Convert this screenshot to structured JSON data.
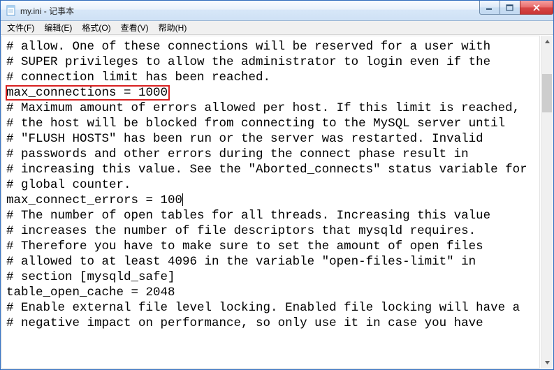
{
  "window": {
    "title": "my.ini - 记事本"
  },
  "menu": {
    "file": "文件(F)",
    "edit": "编辑(E)",
    "format": "格式(O)",
    "view": "查看(V)",
    "help": "帮助(H)"
  },
  "content": {
    "l1": "# allow. One of these connections will be reserved for a user with",
    "l2": "# SUPER privileges to allow the administrator to login even if the",
    "l3": "# connection limit has been reached.",
    "l4": "max_connections = 1000",
    "l5": "",
    "l6": "# Maximum amount of errors allowed per host. If this limit is reached,",
    "l7": "# the host will be blocked from connecting to the MySQL server until",
    "l8": "# \"FLUSH HOSTS\" has been run or the server was restarted. Invalid",
    "l9": "# passwords and other errors during the connect phase result in",
    "l10": "# increasing this value. See the \"Aborted_connects\" status variable for",
    "l11": "# global counter.",
    "l12": "max_connect_errors = 100",
    "l13": "",
    "l14": "# The number of open tables for all threads. Increasing this value",
    "l15": "# increases the number of file descriptors that mysqld requires.",
    "l16": "# Therefore you have to make sure to set the amount of open files",
    "l17": "# allowed to at least 4096 in the variable \"open-files-limit\" in",
    "l18": "# section [mysqld_safe]",
    "l19": "table_open_cache = 2048",
    "l20": "",
    "l21": "# Enable external file level locking. Enabled file locking will have a",
    "l22": "# negative impact on performance, so only use it in case you have"
  }
}
